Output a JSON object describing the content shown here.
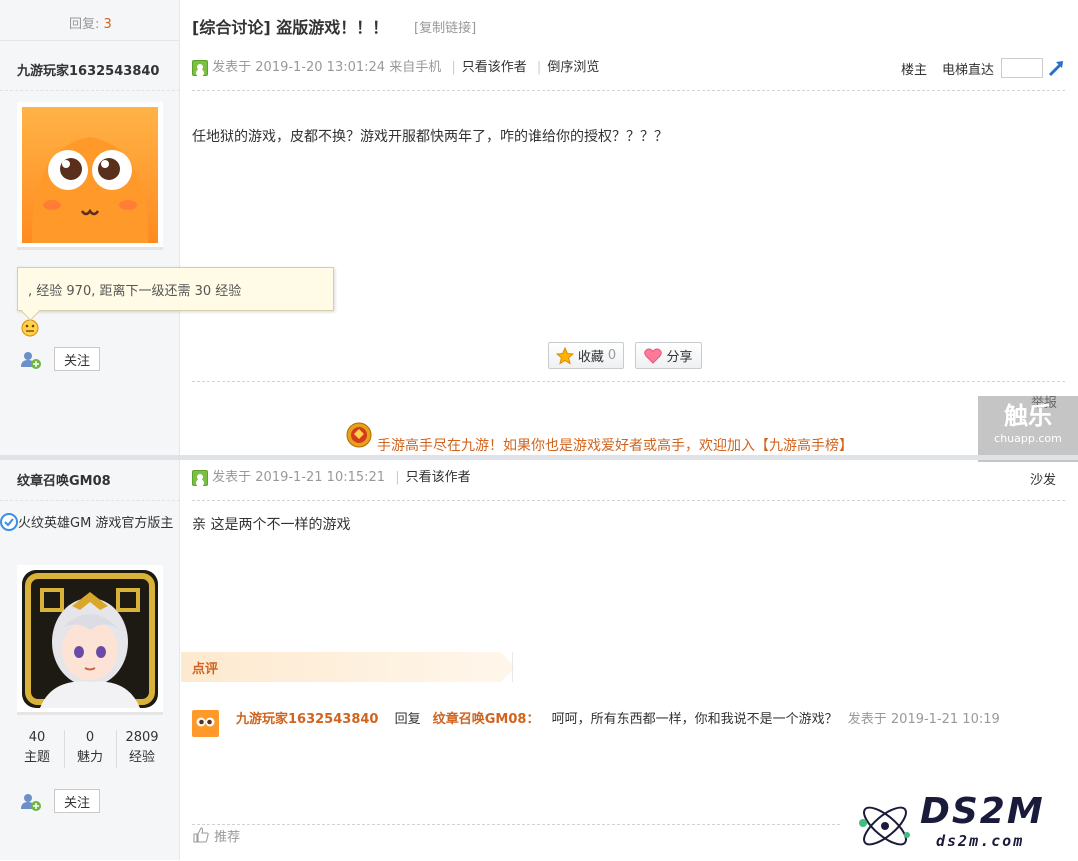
{
  "post1": {
    "replies_label": "回复:",
    "replies_count": "3",
    "author": "九游玩家1632543840",
    "tooltip": ", 经验 970, 距离下一级还需 30 经验",
    "follow": "关注",
    "title": "[综合讨论] 盗版游戏！！！",
    "copy_link": "[复制链接]",
    "posted": "发表于 2019-1-20 13:01:24",
    "from_mobile": "来自手机",
    "only_author": "只看该作者",
    "reverse": "倒序浏览",
    "floor": "楼主",
    "elevator": "电梯直达",
    "content": "任地狱的游戏，皮都不换？游戏开服都快两年了，咋的谁给你的授权？？？？",
    "favorite": "收藏",
    "favorite_count": "0",
    "share": "分享",
    "report": "举报",
    "banner": "手游高手尽在九游！如果你也是游戏爱好者或高手，欢迎加入【九游高手榜】"
  },
  "post2": {
    "author": "纹章召唤GM08",
    "role": "火纹英雄GM 游戏官方版主",
    "stats": [
      {
        "value": "40",
        "label": "主题"
      },
      {
        "value": "0",
        "label": "魅力"
      },
      {
        "value": "2809",
        "label": "经验"
      }
    ],
    "follow": "关注",
    "posted": "发表于 2019-1-21 10:15:21",
    "only_author": "只看该作者",
    "floor": "沙发",
    "content": "亲 这是两个不一样的游戏",
    "comment_header": "点评",
    "comment": {
      "user": "九游玩家1632543840",
      "reply": "回复",
      "target": "纹章召唤GM08：",
      "text": "呵呵，所有东西都一样，你和我说不是一个游戏？",
      "time": "发表于 2019-1-21 10:19"
    },
    "recommend": "推荐"
  },
  "watermarks": {
    "chuapp_cn": "触乐",
    "chuapp_url": "chuapp.com",
    "ds2m": "DS2M",
    "ds2m_url": "ds2m.com"
  }
}
